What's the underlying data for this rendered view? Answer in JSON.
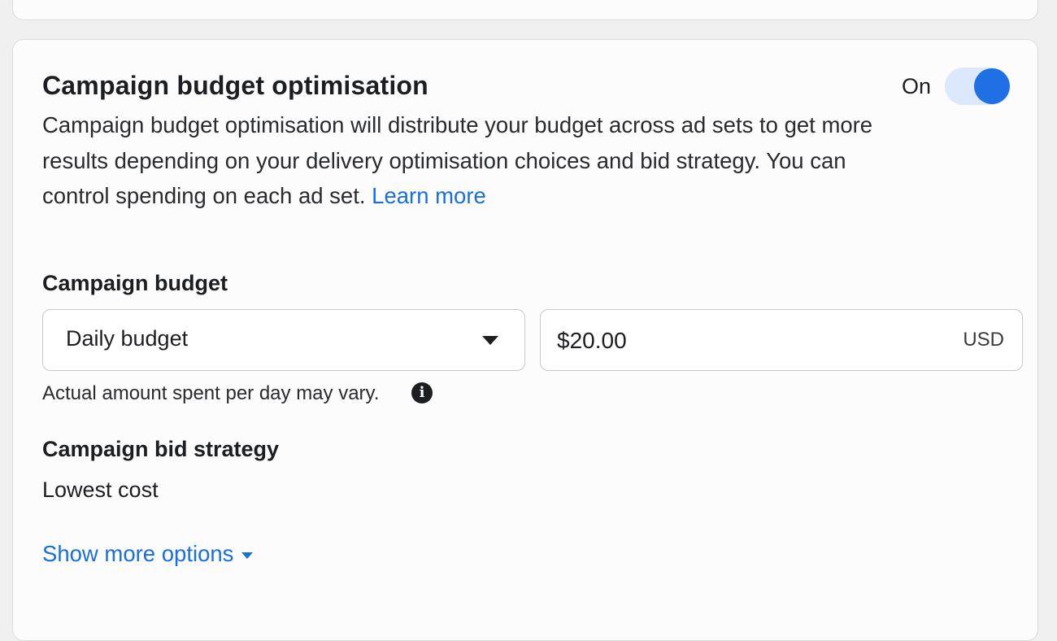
{
  "cbo": {
    "title": "Campaign budget optimisation",
    "description": "Campaign budget optimisation will distribute your budget across ad sets to get more results depending on your delivery optimisation choices and bid strategy. You can control spending on each ad set.",
    "learn_more": "Learn more",
    "toggle_label": "On",
    "toggle_on": true,
    "toggle_color": "#1f6fe5"
  },
  "budget": {
    "label": "Campaign budget",
    "type_selected": "Daily budget",
    "amount": "$20.00",
    "currency": "USD",
    "hint": "Actual amount spent per day may vary.",
    "info_icon": "info-icon"
  },
  "bid": {
    "label": "Campaign bid strategy",
    "value": "Lowest cost"
  },
  "show_more": "Show more options",
  "link_color": "#1a6fdc"
}
